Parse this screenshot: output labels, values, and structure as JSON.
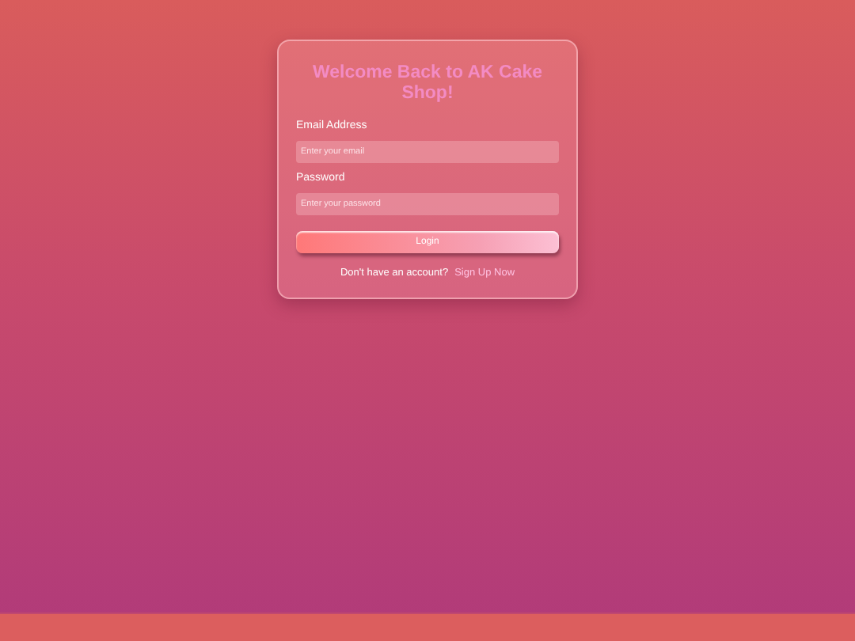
{
  "login_form": {
    "title": "Welcome Back to AK Cake Shop!",
    "fields": [
      {
        "label": "Email Address",
        "placeholder": "Enter your email"
      },
      {
        "label": "Password",
        "placeholder": "Enter your password"
      }
    ],
    "submit_button": "Login",
    "signup_prompt": "Don't have an account?",
    "signup_link": "Sign Up Now"
  }
}
